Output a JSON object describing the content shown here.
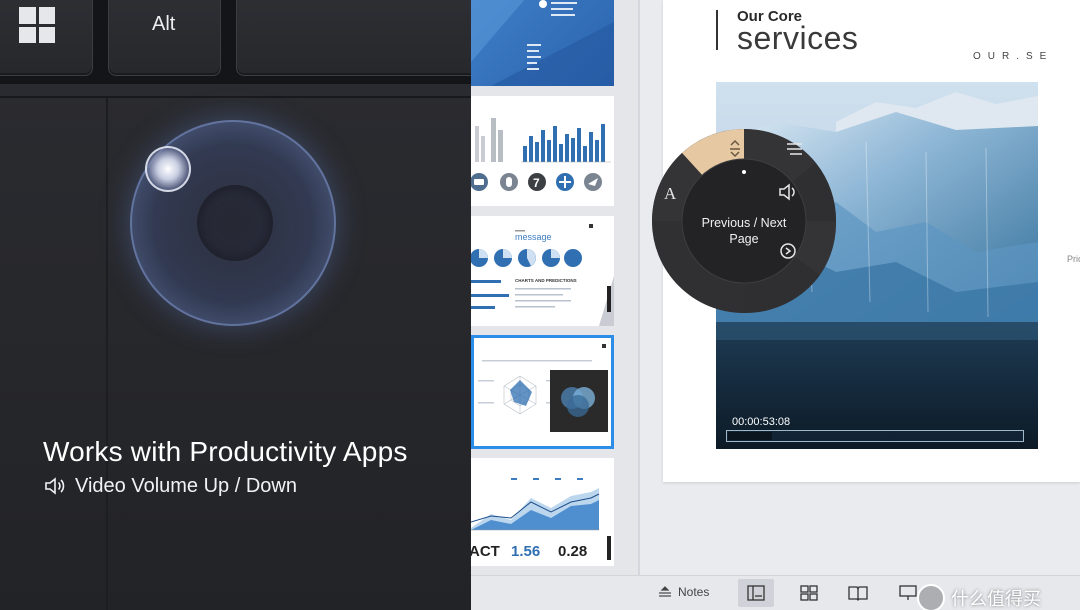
{
  "keyboard": {
    "alt_label": "Alt",
    "windows_key_icon": "windows-logo-icon"
  },
  "touchpad": {
    "gesture": "two-finger radial dial"
  },
  "caption": {
    "title": "Works with Productivity Apps",
    "subtitle": "Video Volume Up / Down",
    "subtitle_icon": "speaker-icon"
  },
  "slide": {
    "kicker": "Our Core",
    "title": "services",
    "spaced_text": "OUR.SE",
    "side_text": "Pric",
    "video_time": "00:00:53:08",
    "video_progress": 0.15
  },
  "thumbnails": {
    "stat_1": "ACT",
    "stat_2": "1.56",
    "stat_3": "0.28",
    "thumb3_heading": "message",
    "thumb3_sub": "CHARTS AND PREDICTIONS"
  },
  "radial_menu": {
    "center_label": "Previous / Next Page",
    "segments": [
      {
        "icon": "up-down-arrows-icon",
        "active": true
      },
      {
        "icon": "scroll-lines-icon",
        "active": false
      },
      {
        "icon": "volume-icon",
        "active": false
      },
      {
        "icon": "redo-icon",
        "active": false
      },
      {
        "icon": "text-size-icon",
        "active": false
      }
    ],
    "accent": "#e6c9a2"
  },
  "status_bar": {
    "notes_label": "Notes",
    "views": [
      "normal-view-icon",
      "slide-sorter-icon",
      "reading-view-icon",
      "presenter-view-icon"
    ]
  },
  "watermark": {
    "text": "什么值得买"
  }
}
